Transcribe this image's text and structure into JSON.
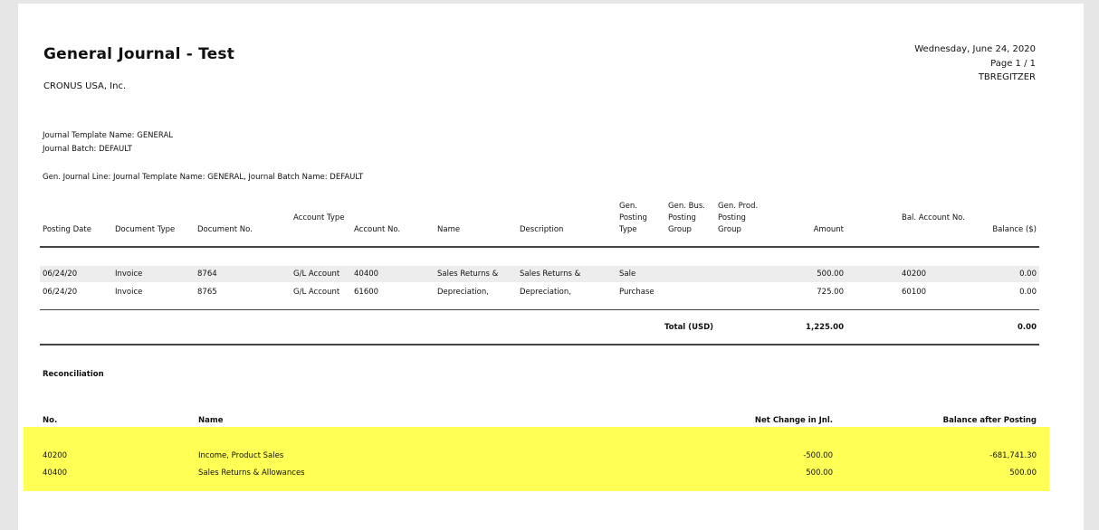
{
  "report": {
    "title": "General Journal - Test",
    "company": "CRONUS USA, Inc.",
    "date": "Wednesday, June 24, 2020",
    "page": "Page 1 / 1",
    "user": "TBREGITZER"
  },
  "filters": {
    "template": "Journal Template Name: GENERAL",
    "batch": "Journal Batch: DEFAULT",
    "line": "Gen. Journal Line: Journal Template Name: GENERAL, Journal Batch Name: DEFAULT"
  },
  "columns": {
    "posting_date": "Posting Date",
    "document_type": "Document Type",
    "document_no": "Document No.",
    "account_type": "Account Type",
    "account_no": "Account No.",
    "name": "Name",
    "description": "Description",
    "gen_posting_type": "Gen. Posting Type",
    "gen_bus_posting_group": "Gen. Bus. Posting Group",
    "gen_prod_posting_group": "Gen. Prod. Posting Group",
    "amount": "Amount",
    "bal_account_no": "Bal. Account No.",
    "balance": "Balance ($)"
  },
  "rows": [
    {
      "posting_date": "06/24/20",
      "document_type": "Invoice",
      "document_no": "8764",
      "account_type": "G/L Account",
      "account_no": "40400",
      "name": "Sales Returns &",
      "description": "Sales Returns &",
      "gen_posting_type": "Sale",
      "amount": "500.00",
      "bal_account_no": "40200",
      "balance": "0.00"
    },
    {
      "posting_date": "06/24/20",
      "document_type": "Invoice",
      "document_no": "8765",
      "account_type": "G/L Account",
      "account_no": "61600",
      "name": "Depreciation,",
      "description": "Depreciation,",
      "gen_posting_type": "Purchase",
      "amount": "725.00",
      "bal_account_no": "60100",
      "balance": "0.00"
    }
  ],
  "total": {
    "label": "Total (USD)",
    "amount": "1,225.00",
    "balance": "0.00"
  },
  "reconciliation": {
    "title": "Reconciliation",
    "columns": {
      "no": "No.",
      "name": "Name",
      "net_change": "Net Change in Jnl.",
      "balance_after": "Balance after Posting"
    },
    "rows": [
      {
        "no": "40200",
        "name": "Income, Product Sales",
        "net_change": "-500.00",
        "balance_after": "-681,741.30"
      },
      {
        "no": "40400",
        "name": "Sales Returns & Allowances",
        "net_change": "500.00",
        "balance_after": "500.00"
      }
    ]
  },
  "colors": {
    "highlight": "#ffff55",
    "row_shade": "#ededed",
    "page_background": "#e6e6e6"
  }
}
